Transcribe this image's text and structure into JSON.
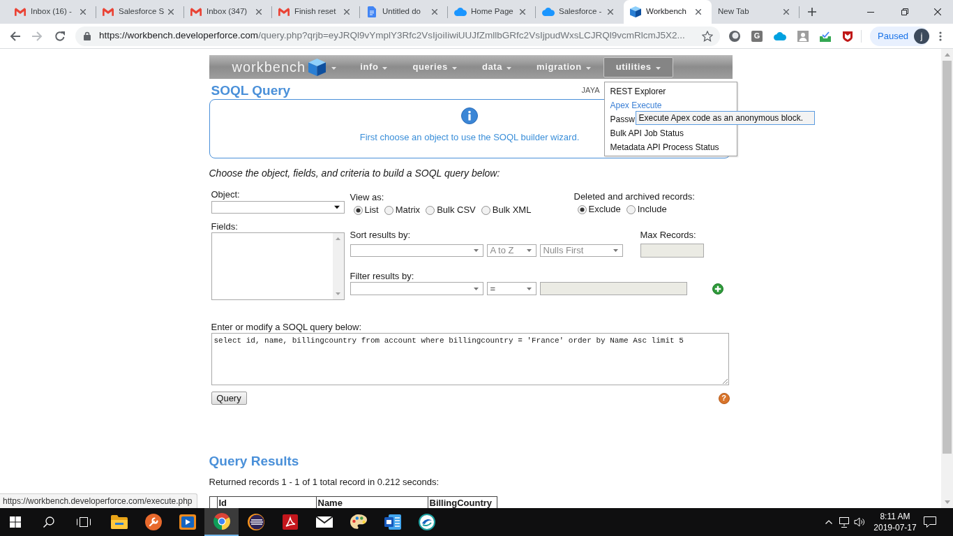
{
  "browser": {
    "tabs": [
      {
        "title": "Inbox (16) -",
        "kind": "mail",
        "selected": false
      },
      {
        "title": "Salesforce S",
        "kind": "mail",
        "selected": false
      },
      {
        "title": "Inbox (347)",
        "kind": "mail",
        "selected": false
      },
      {
        "title": "Finish reset",
        "kind": "mail",
        "selected": false
      },
      {
        "title": "Untitled do",
        "kind": "doc",
        "selected": false
      },
      {
        "title": "Home Page",
        "kind": "cloud",
        "selected": false
      },
      {
        "title": "Salesforce -",
        "kind": "cloud",
        "selected": false
      },
      {
        "title": "Workbench",
        "kind": "cube",
        "selected": true
      },
      {
        "title": "New Tab",
        "kind": "blank",
        "selected": false
      }
    ],
    "address": {
      "host": "https://workbench.developerforce.com",
      "path": "/query.php?qrjb=eyJRQl9vYmplY3Rfc2VsIjoiIiwiUUJfZmllbGRfc2VsIjpudWxsLCJRQl9vcmRlcmJ5X2..."
    },
    "extension_badge": "G",
    "profile": {
      "label": "Paused",
      "initial": "j"
    }
  },
  "workbench": {
    "logo": "workbench",
    "menu": [
      {
        "label": "info",
        "selected": false
      },
      {
        "label": "queries",
        "selected": false
      },
      {
        "label": "data",
        "selected": false
      },
      {
        "label": "migration",
        "selected": false
      },
      {
        "label": "utilities",
        "selected": true
      }
    ],
    "page_title": "SOQL Query",
    "user": "JAYA",
    "utilities_menu": [
      {
        "label": "REST Explorer",
        "hovered": false
      },
      {
        "label": "Apex Execute",
        "hovered": true
      },
      {
        "label": "Passw",
        "hovered": false
      },
      {
        "label": "Bulk API Job Status",
        "hovered": false
      },
      {
        "label": "Metadata API Process Status",
        "hovered": false
      }
    ],
    "tooltip": "Execute Apex code as an anonymous block.",
    "info": "First choose an object to use the SOQL builder wizard.",
    "instructions": "Choose the object, fields, and criteria to build a SOQL query below:",
    "object": {
      "label": "Object:"
    },
    "view_as": {
      "label": "View as:",
      "options": [
        {
          "label": "List",
          "selected": true
        },
        {
          "label": "Matrix",
          "selected": false
        },
        {
          "label": "Bulk CSV",
          "selected": false
        },
        {
          "label": "Bulk XML",
          "selected": false
        }
      ]
    },
    "deleted": {
      "label": "Deleted and archived records:",
      "options": [
        {
          "label": "Exclude",
          "selected": true
        },
        {
          "label": "Include",
          "selected": false
        }
      ]
    },
    "fields": {
      "label": "Fields:"
    },
    "sort": {
      "label": "Sort results by:",
      "direction": "A to Z",
      "nulls": "Nulls First",
      "disabled": true
    },
    "max_records": {
      "label": "Max Records:",
      "disabled": true
    },
    "filter": {
      "label": "Filter results by:",
      "operator": "=",
      "value": {
        "disabled": true
      }
    },
    "query": {
      "label": "Enter or modify a SOQL query below:",
      "value": "select id, name, billingcountry from account where billingcountry = 'France' order by Name Asc limit 5",
      "button": "Query",
      "help": "?"
    },
    "results": {
      "title": "Query Results",
      "summary": "Returned records 1 - 1 of 1 total record in 0.212 seconds:",
      "columns": [
        "Id",
        "Name",
        "BillingCountry"
      ]
    }
  },
  "status_bubble": "https://workbench.developerforce.com/execute.php",
  "taskbar": {
    "apps": [
      {
        "kind": "folder",
        "selected": false
      },
      {
        "kind": "wrench",
        "selected": false
      },
      {
        "kind": "player",
        "selected": false
      },
      {
        "kind": "browser",
        "selected": true
      },
      {
        "kind": "stripes",
        "selected": false
      },
      {
        "kind": "pdf",
        "selected": false
      },
      {
        "kind": "mail",
        "selected": false
      },
      {
        "kind": "paint",
        "selected": false
      },
      {
        "kind": "doc",
        "selected": false
      },
      {
        "kind": "sphere",
        "selected": false
      }
    ],
    "time": "8:11 AM",
    "date": "2019-07-17"
  }
}
